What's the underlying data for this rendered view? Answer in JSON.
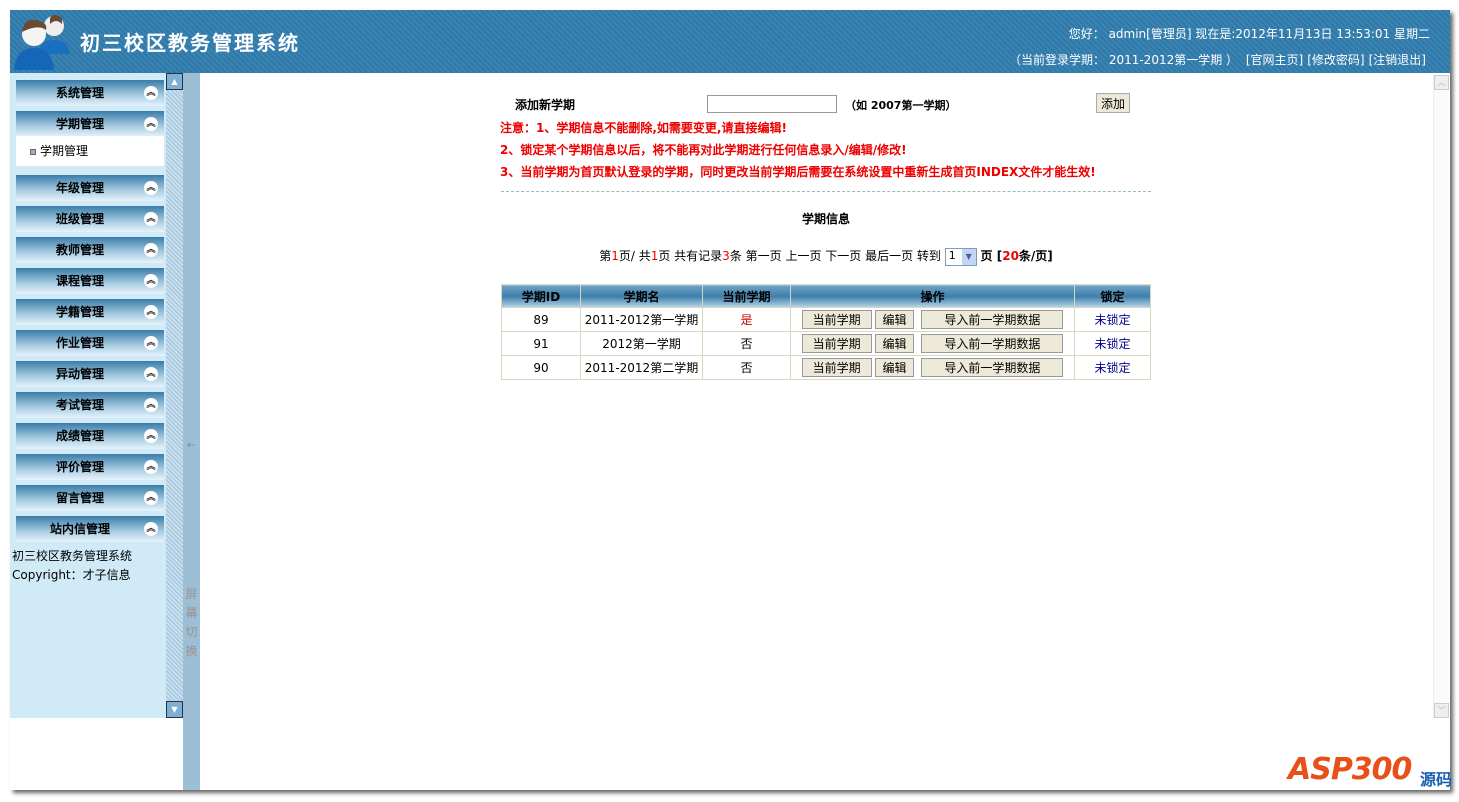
{
  "header": {
    "title": "初三校区教务管理系统",
    "greeting": "您好： admin[管理员]  现在是:2012年11月13日 13:53:01 星期二",
    "current_term": "（当前登录学期： 2011-2012第一学期 ）",
    "links": [
      "[官网主页]",
      "[修改密码]",
      "[注销退出]"
    ]
  },
  "sidebar": {
    "menus": [
      "系统管理",
      "学期管理",
      "年级管理",
      "班级管理",
      "教师管理",
      "课程管理",
      "学籍管理",
      "作业管理",
      "异动管理",
      "考试管理",
      "成绩管理",
      "评价管理",
      "留言管理",
      "站内信管理"
    ],
    "submenu": "学期管理",
    "footer1": "初三校区教务管理系统",
    "footer2": "Copyright：才子信息",
    "toggle_label": "屏幕切换",
    "toggle_chars": [
      "屏",
      "幕",
      "切",
      "换"
    ]
  },
  "form": {
    "label": "添加新学期",
    "input_value": "",
    "hint": "（如 2007第一学期）",
    "add_button": "添加",
    "notes": [
      "注意：1、学期信息不能删除,如需要变更,请直接编辑!",
      "2、锁定某个学期信息以后，将不能再对此学期进行任何信息录入/编辑/修改!",
      "3、当前学期为首页默认登录的学期，同时更改当前学期后需要在系统设置中重新生成首页INDEX文件才能生效!"
    ]
  },
  "section_title": "学期信息",
  "pager": {
    "p1": "第",
    "page": "1",
    "p2": "页/ 共",
    "total_pages": "1",
    "p3": "页 共有记录",
    "records": "3",
    "p4": "条 第一页 上一页 下一页 最后一页 转到",
    "goto": "1",
    "p5": "页 [",
    "per_page": "20",
    "p6": "条/页]"
  },
  "table": {
    "headers": [
      "学期ID",
      "学期名",
      "当前学期",
      "操作",
      "锁定"
    ],
    "rows": [
      {
        "id": "89",
        "name": "2011-2012第一学期",
        "current": "是",
        "lock": "未锁定"
      },
      {
        "id": "91",
        "name": "2012第一学期",
        "current": "否",
        "lock": "未锁定"
      },
      {
        "id": "90",
        "name": "2011-2012第二学期",
        "current": "否",
        "lock": "未锁定"
      }
    ],
    "btn_current": "当前学期",
    "btn_edit": "编辑",
    "btn_import": "导入前一学期数据"
  },
  "watermark": {
    "logo": "ASP300",
    "sub": "源码"
  }
}
